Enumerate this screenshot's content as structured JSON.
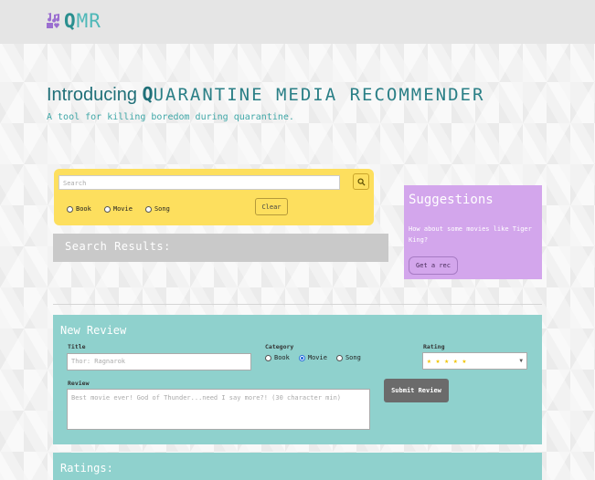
{
  "logo": {
    "text_q": "Q",
    "text_rest": "MR",
    "icon": "music-book-heart-icon"
  },
  "hero": {
    "title_prefix": "Introducing ",
    "title_q": "Q",
    "title_rest": "UARANTINE MEDIA RECOMMENDER",
    "tagline": "A tool for killing boredom during quarantine."
  },
  "search": {
    "placeholder": "Search",
    "button_icon": "search-icon",
    "options": [
      "Book",
      "Movie",
      "Song"
    ],
    "clear_label": "Clear"
  },
  "results": {
    "title": "Search Results:"
  },
  "suggestions": {
    "title": "Suggestions",
    "text": "How about some movies like Tiger King?",
    "button_label": "Get a rec"
  },
  "review": {
    "title": "New Review",
    "title_label": "Title",
    "title_placeholder": "Thor: Ragnarok",
    "category_label": "Category",
    "categories": [
      "Book",
      "Movie",
      "Song"
    ],
    "selected_category": "Movie",
    "rating_label": "Rating",
    "rating_value": "★ ★ ★ ★ ★",
    "review_label": "Review",
    "review_placeholder": "Best movie ever! God of Thunder...need I say more?! (30 character min)",
    "submit_label": "Submit Review"
  },
  "ratings": {
    "title": "Ratings:"
  },
  "colors": {
    "teal": "#8fd1cd",
    "yellow": "#fddf5e",
    "purple": "#d3a6ec",
    "grey": "#c9c9c9"
  }
}
